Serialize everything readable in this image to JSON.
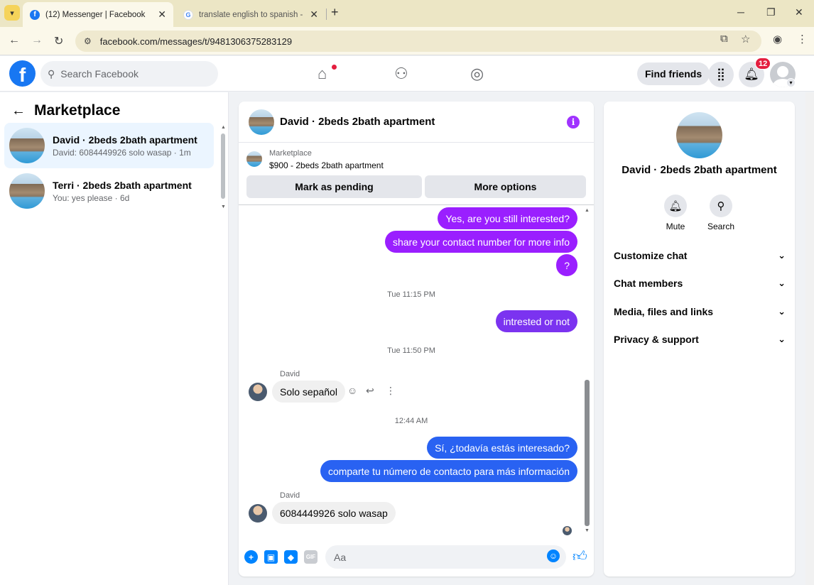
{
  "browser": {
    "tabs": [
      {
        "title": "(12) Messenger | Facebook",
        "favicon": "facebook-icon"
      },
      {
        "title": "translate english to spanish - Go",
        "favicon": "google-icon"
      }
    ],
    "url": "facebook.com/messages/t/9481306375283129"
  },
  "fb_header": {
    "logo_letter": "f",
    "search_placeholder": "Search Facebook",
    "find_friends_label": "Find friends",
    "notification_count": "12"
  },
  "sidebar": {
    "title": "Marketplace",
    "conversations": [
      {
        "name": "David · 2beds 2bath apartment",
        "snippet": "David: 6084449926 solo wasap · 1m"
      },
      {
        "name": "Terri · 2beds 2bath apartment",
        "snippet": "You: yes please · 6d"
      }
    ]
  },
  "chat": {
    "title": "David · 2beds 2bath apartment",
    "listing_source": "Marketplace",
    "listing_price": "$900 - 2beds 2bath apartment",
    "mark_pending_label": "Mark as pending",
    "more_options_label": "More options",
    "messages": {
      "m1": "Yes, are you still interested?",
      "m2": "share your contact number for more info",
      "m3": "?",
      "t1": "Tue 11:15 PM",
      "m4": "intrested or not",
      "t2": "Tue 11:50 PM",
      "sender1": "David",
      "m5": "Solo sepañol",
      "t3": "12:44 AM",
      "m6": "Sí, ¿todavía estás interesado?",
      "m7": "comparte tu número de contacto para más información",
      "sender2": "David",
      "m8": "6084449926 solo wasap"
    },
    "composer_placeholder": "Aa",
    "gif_label": "GIF"
  },
  "details": {
    "name": "David · 2beds 2bath apartment",
    "mute_label": "Mute",
    "search_label": "Search",
    "sections": [
      "Customize chat",
      "Chat members",
      "Media, files and links",
      "Privacy & support"
    ]
  },
  "colors": {
    "fb_blue": "#1877f2",
    "bubble_purple": "#9a1fff",
    "bubble_violet": "#7b33f0",
    "bubble_blue": "#2962f2"
  }
}
